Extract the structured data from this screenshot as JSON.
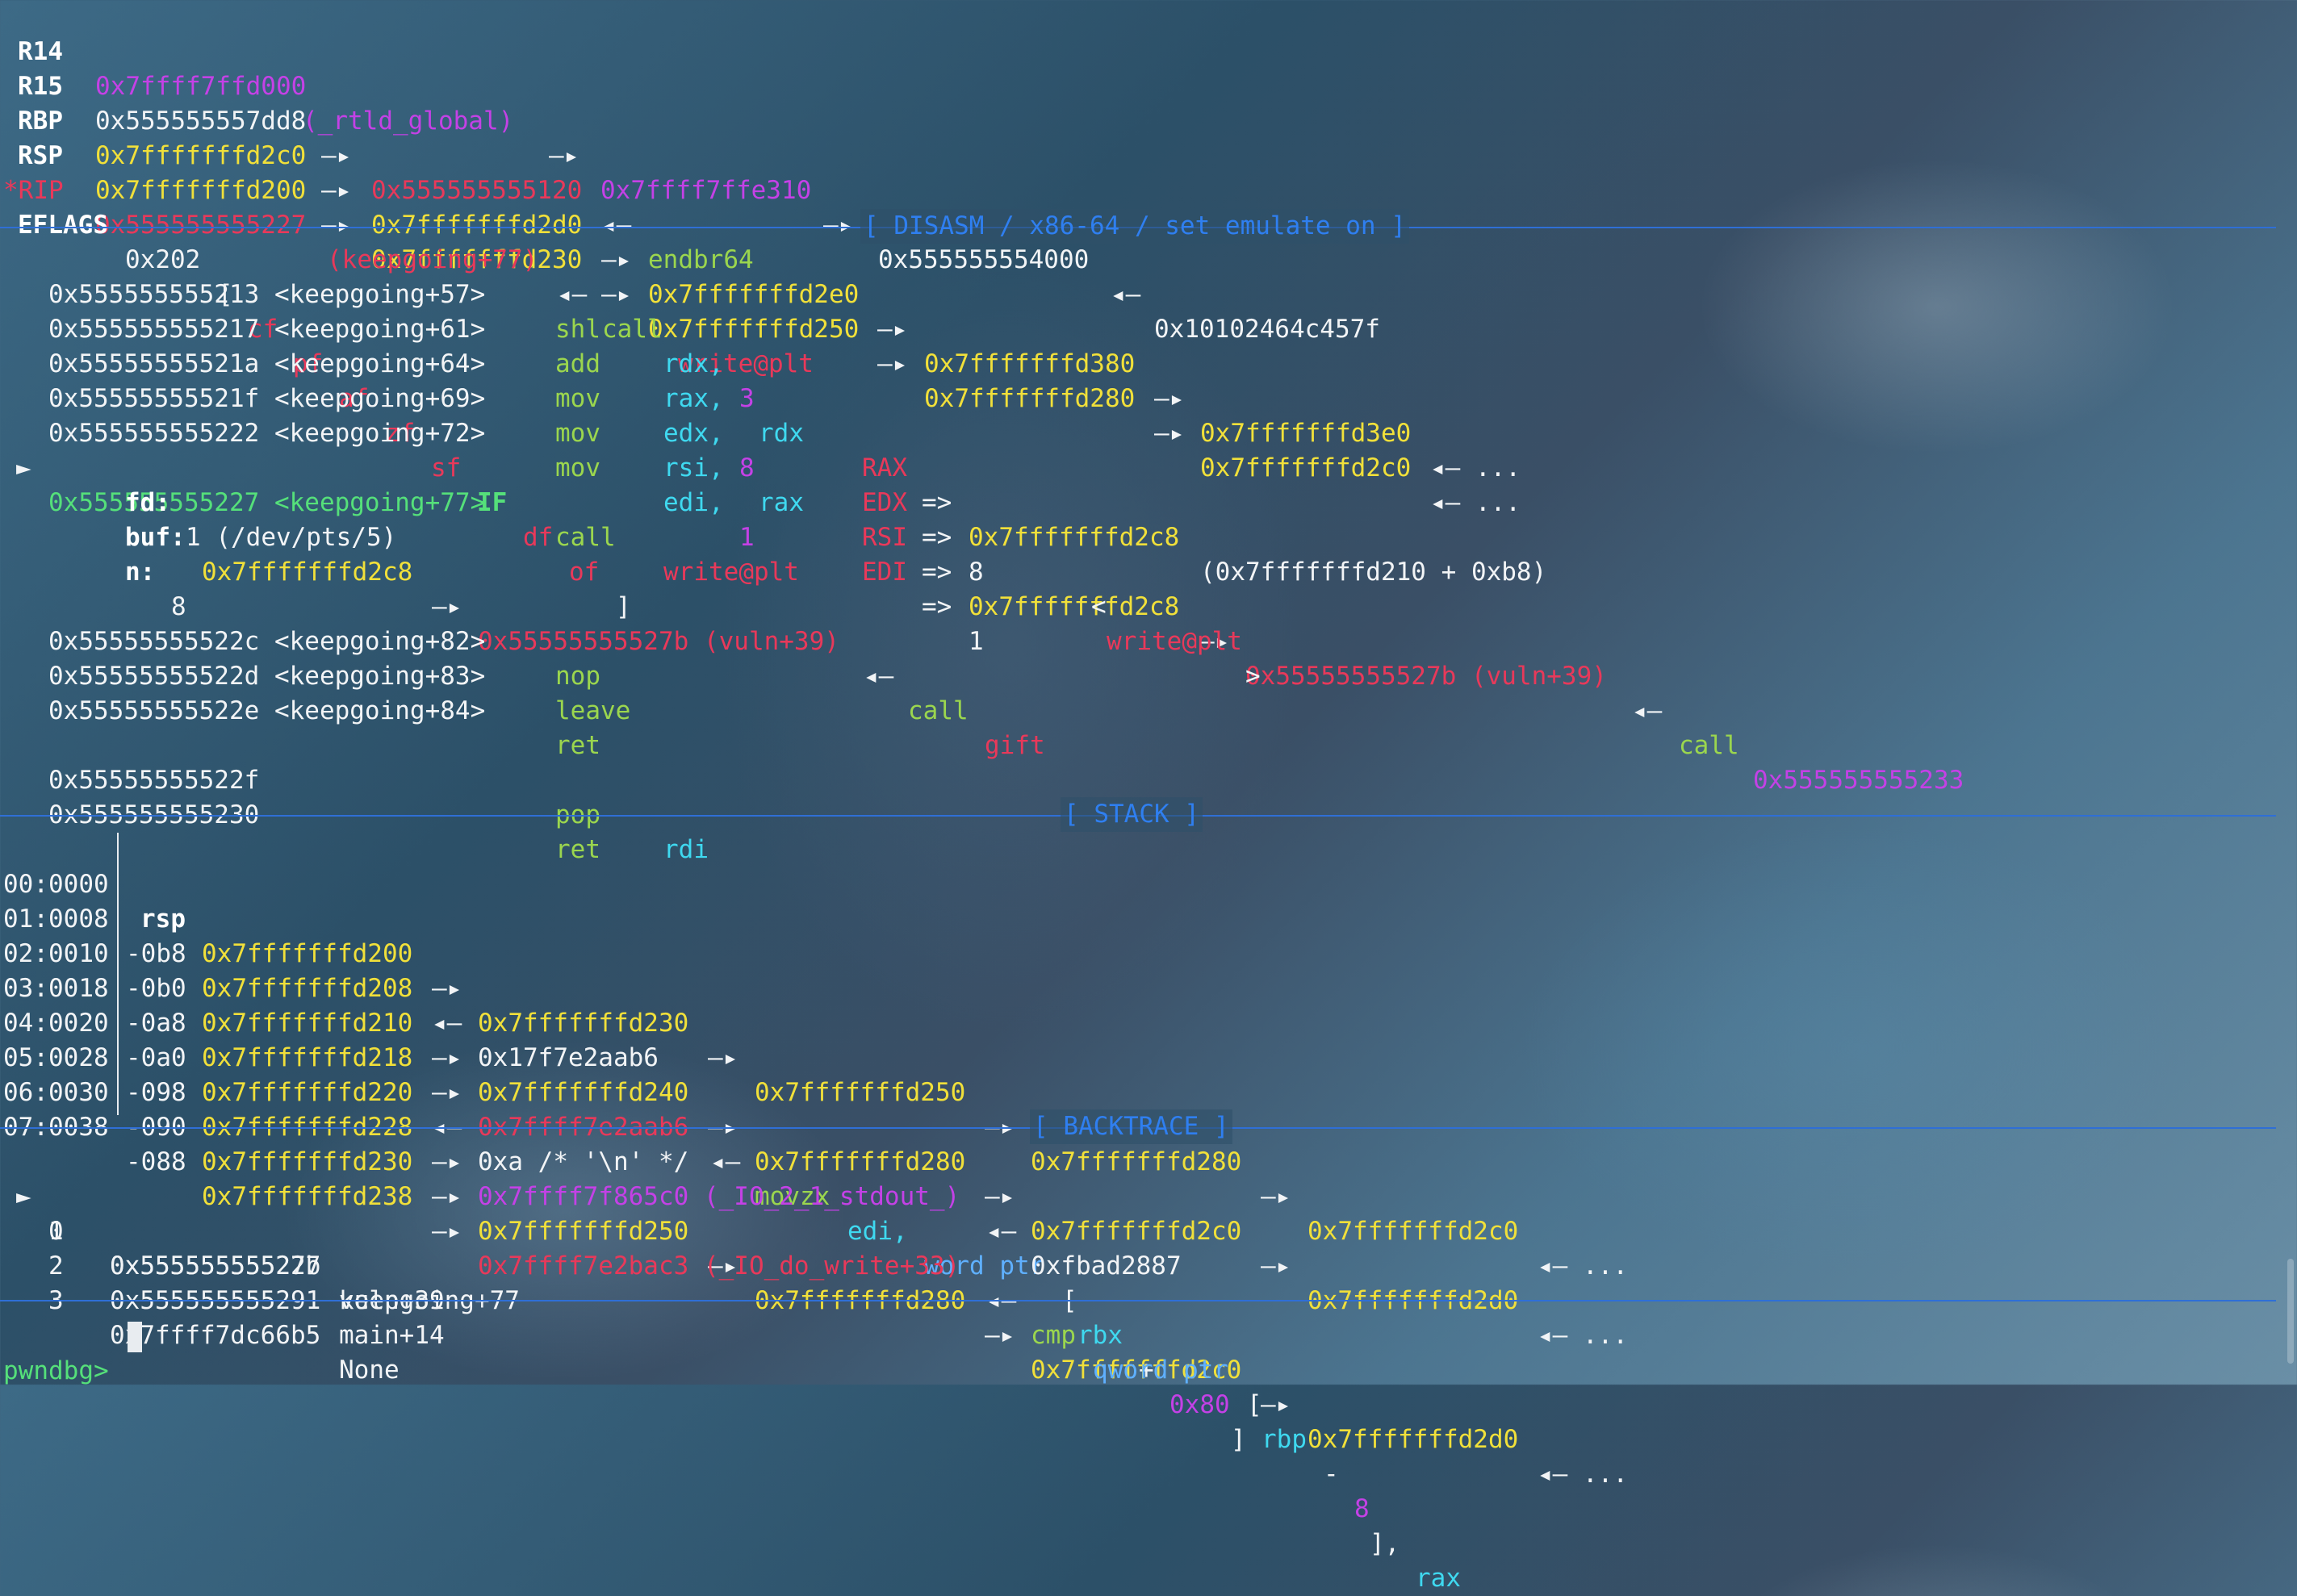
{
  "registers": {
    "r14": {
      "name": "R14",
      "p1": "0x7ffff7ffd000",
      "p1sym": "(_rtld_global)",
      "a1": "—▸",
      "p2": "0x7ffff7ffe310",
      "a2": "—▸",
      "p3": "0x555555554000",
      "a3": "◂—",
      "p4": "0x10102464c457f"
    },
    "r15": {
      "name": "R15",
      "p1": "0x555555557dd8",
      "a1": "—▸",
      "p2": "0x555555555120",
      "a2": "◂—",
      "p3": "endbr64"
    },
    "rbp": {
      "name": "RBP",
      "p1": "0x7fffffffd2c0",
      "p2": "0x7fffffffd2d0",
      "p3": "0x7fffffffd2e0",
      "p4": "0x7fffffffd380",
      "p5": "0x7fffffffd3e0",
      "tail": "◂— ...",
      "arr": "—▸"
    },
    "rsp": {
      "name": "RSP",
      "p1": "0x7fffffffd200",
      "p2": "0x7fffffffd230",
      "p3": "0x7fffffffd250",
      "p4": "0x7fffffffd280",
      "p5": "0x7fffffffd2c0",
      "tail": "◂— ...",
      "arr": "—▸"
    },
    "rip": {
      "name": "*RIP",
      "p1": "0x555555555227",
      "sym": "(keepgoing+77)",
      "arr": "◂—",
      "ins": "call",
      "fn": "write@plt"
    },
    "eflags": {
      "label": "EFLAGS",
      "val": "0x202",
      "open": "[",
      "f1": "cf",
      "f2": "pf",
      "f3": "af",
      "f4": "zf",
      "f5": "sf",
      "f6": "IF",
      "f7": "df",
      "f8": "of",
      "close": "]"
    }
  },
  "headers": {
    "disasm": "[ DISASM / x86-64 / set emulate on ]",
    "stack": "[ STACK ]",
    "backtrace": "[ BACKTRACE ]"
  },
  "disasm": {
    "l1": {
      "addr": "0x555555555213 <keepgoing+57>",
      "mn": "shl",
      "op1": "rdx,",
      "op2": "3"
    },
    "l2": {
      "addr": "0x555555555217 <keepgoing+61>",
      "mn": "add",
      "op1": "rax,",
      "op2": "rdx",
      "reg": "RAX",
      "eq": "=>",
      "val": "0x7fffffffd2c8",
      "note": "(0x7fffffffd210 + 0xb8)"
    },
    "l3": {
      "addr": "0x55555555521a <keepgoing+64>",
      "mn": "mov",
      "op1": "edx,",
      "op2": "8",
      "reg": "EDX",
      "eq": "=>",
      "val": "8"
    },
    "l4": {
      "addr": "0x55555555521f <keepgoing+69>",
      "mn": "mov",
      "op1": "rsi,",
      "op2": "rax",
      "reg": "RSI",
      "eq": "=>",
      "val": "0x7fffffffd2c8",
      "arr": "—▸",
      "v2": "0x55555555527b (vuln+39)",
      "arr2": "◂—",
      "ins": "call",
      "tgt": "0x555555555233"
    },
    "l5": {
      "addr": "0x555555555222 <keepgoing+72>",
      "mn": "mov",
      "op1": "edi,",
      "op2": "1",
      "reg": "EDI",
      "eq": "=>",
      "val": "1"
    },
    "cur": {
      "mark": "►",
      "addr": "0x555555555227 <keepgoing+77>",
      "mn": "call",
      "fn": "write@plt",
      "lt": "<",
      "fn2": "write@plt",
      "gt": ">"
    },
    "fd": {
      "k": "fd:",
      "v": "1 (/dev/pts/5)"
    },
    "buf": {
      "k": "buf:",
      "v": "0x7fffffffd2c8",
      "arr": "—▸",
      "v2": "0x55555555527b (vuln+39)",
      "arr2": "◂—",
      "ins": "call",
      "fn": "gift"
    },
    "n": {
      "k": "n:",
      "v": "8"
    },
    "l6": {
      "addr": "0x55555555522c <keepgoing+82>",
      "mn": "nop"
    },
    "l7": {
      "addr": "0x55555555522d <keepgoing+83>",
      "mn": "leave"
    },
    "l8": {
      "addr": "0x55555555522e <keepgoing+84>",
      "mn": "ret"
    },
    "l9": {
      "addr": "0x55555555522f",
      "mn": "pop",
      "op1": "rdi"
    },
    "l10": {
      "addr": "0x555555555230",
      "mn": "ret"
    }
  },
  "stack": [
    {
      "idx": "00:0000",
      "off": "rsp",
      "a": "0x7fffffffd200",
      "b": "0x7fffffffd230",
      "c": "0x7fffffffd250",
      "d": "0x7fffffffd280",
      "e": "0x7fffffffd2c0",
      "tail": "◂— ..."
    },
    {
      "idx": "01:0008",
      "off": "-0b8",
      "a": "0x7fffffffd208",
      "arr": "◂—",
      "val": "0x17f7e2aab6"
    },
    {
      "idx": "02:0010",
      "off": "-0b0",
      "a": "0x7fffffffd210",
      "b": "0x7fffffffd240",
      "c": "0x7fffffffd280",
      "d": "0x7fffffffd2c0",
      "e": "0x7fffffffd2d0",
      "tail": "◂— ..."
    },
    {
      "idx": "03:0018",
      "off": "-0a8",
      "a": "0x7fffffffd218",
      "b": "0x7ffff7e2aab6",
      "arr2": "◂—",
      "ins": "movzx",
      "r1": "edi,",
      "w": "word ptr",
      "br1": "[",
      "r2": "rbx",
      "plus": "+",
      "n": "0x80",
      "br2": "]"
    },
    {
      "idx": "04:0020",
      "off": "-0a0",
      "a": "0x7fffffffd220",
      "arr": "◂—",
      "val": "0xa /* '\\n' */"
    },
    {
      "idx": "05:0028",
      "off": "-098",
      "a": "0x7fffffffd228",
      "b": "0x7ffff7f865c0 (_IO_2_1_stdout_)",
      "arr2": "◂—",
      "val": "0xfbad2887"
    },
    {
      "idx": "06:0030",
      "off": "-090",
      "a": "0x7fffffffd230",
      "b": "0x7fffffffd250",
      "c": "0x7fffffffd280",
      "d": "0x7fffffffd2c0",
      "e": "0x7fffffffd2d0",
      "tail": "◂— ..."
    },
    {
      "idx": "07:0038",
      "off": "-088",
      "a": "0x7fffffffd238",
      "b": "0x7ffff7e2bac3 (_IO_do_write+33)",
      "arr2": "◂—",
      "ins": "cmp",
      "w": "qword ptr",
      "br1": "[",
      "r2": "rbp",
      "minus": "-",
      "n": "8",
      "br2": "],",
      "r3": "rax"
    }
  ],
  "arrow": "—▸",
  "backtrace": [
    {
      "mark": "►",
      "n": "0",
      "addr": "0x555555555227",
      "sym": "keepgoing+77"
    },
    {
      "mark": "",
      "n": "1",
      "addr": "0x55555555527b",
      "sym": "vuln+39"
    },
    {
      "mark": "",
      "n": "2",
      "addr": "0x555555555291",
      "sym": "main+14"
    },
    {
      "mark": "",
      "n": "3",
      "addr": "0x7ffff7dc66b5",
      "sym": "None"
    }
  ],
  "prompt": "pwndbg>"
}
